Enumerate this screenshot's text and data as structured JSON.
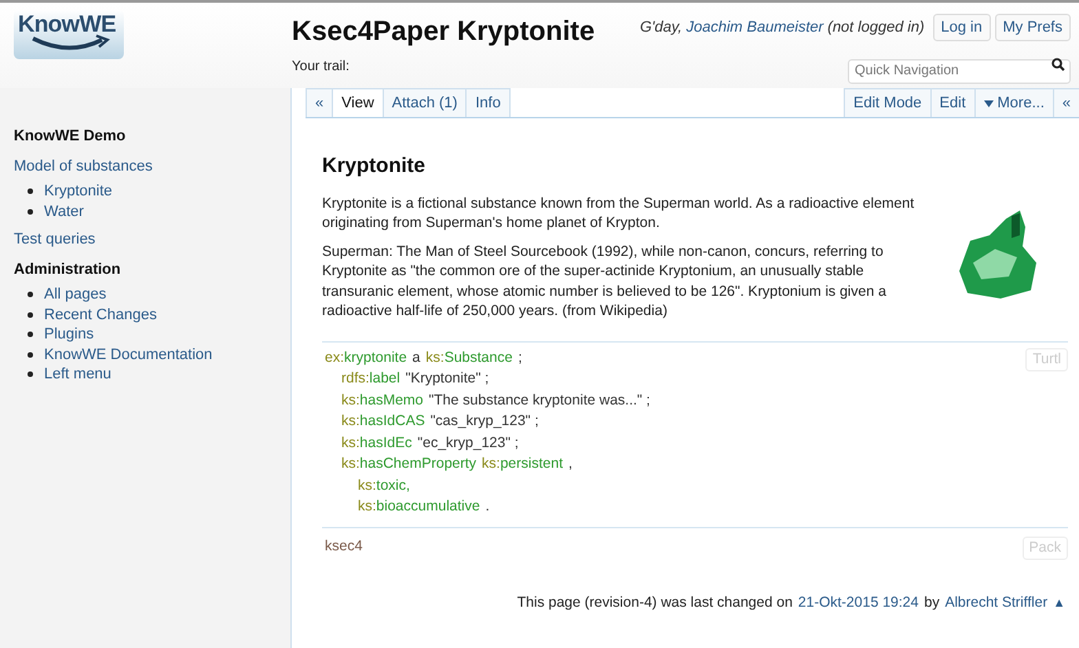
{
  "header": {
    "logo": "KnowWE",
    "title": "Ksec4Paper Kryptonite",
    "greeting": "G'day,",
    "user": "Joachim Baumeister",
    "login_state": "(not logged in)",
    "buttons": [
      "Log in",
      "My Prefs"
    ],
    "search": {
      "placeholder": "Quick Navigation"
    },
    "trail": "Your trail:"
  },
  "tabs_left": [
    {
      "label": "«",
      "selected": false
    },
    {
      "label": "View",
      "selected": true
    },
    {
      "label": "Attach (1)",
      "selected": false
    },
    {
      "label": "Info",
      "selected": false
    }
  ],
  "tabs_right": [
    {
      "label": "Edit Mode",
      "caret": false
    },
    {
      "label": "Edit",
      "caret": false
    },
    {
      "label": "More...",
      "caret": true
    },
    {
      "label": "«",
      "caret": false
    }
  ],
  "sidebar": {
    "sections": [
      {
        "kind": "heading",
        "label": "KnowWE Demo"
      },
      {
        "kind": "link",
        "label": "Model of substances",
        "items": [
          "Kryptonite",
          "Water"
        ]
      },
      {
        "kind": "link",
        "label": "Test queries"
      },
      {
        "kind": "heading",
        "label": "Administration",
        "items": [
          "All pages",
          "Recent Changes",
          "Plugins",
          "KnowWE Documentation",
          "Left menu"
        ]
      }
    ]
  },
  "article": {
    "title": "Kryptonite",
    "paragraphs": [
      "Kryptonite is a fictional substance known from the Superman world. As a radioactive element originating from Superman's home planet of Krypton.",
      "Superman: The Man of Steel Sourcebook (1992), while non-canon, concurs, referring to Kryptonite as \"the common ore of the super-actinide Kryptonium, an unusually stable transuranic element, whose atomic number is believed to be 126\". Kryptonium is given a radioactive half-life of 250,000 years. (from Wikipedia)"
    ]
  },
  "code_block": {
    "tag": "Turtl",
    "statements": [
      {
        "tokens": [
          {
            "kind": "prefix",
            "text": "ex:"
          },
          {
            "kind": "term",
            "text": "kryptonite"
          },
          {
            "kind": "text",
            "text": "a"
          },
          {
            "kind": "prefix",
            "text": "ks:"
          },
          {
            "kind": "term",
            "text": "Substance"
          },
          {
            "kind": "text",
            "text": ";"
          }
        ],
        "children": [
          {
            "tokens": [
              {
                "kind": "prefix",
                "text": "rdfs:"
              },
              {
                "kind": "term",
                "text": "label"
              },
              {
                "kind": "text",
                "text": "\"Kryptonite\" ;"
              }
            ]
          },
          {
            "tokens": [
              {
                "kind": "prefix",
                "text": "ks:"
              },
              {
                "kind": "term",
                "text": "hasMemo"
              },
              {
                "kind": "text",
                "text": "\"The substance kryptonite was...\" ;"
              }
            ]
          },
          {
            "tokens": [
              {
                "kind": "prefix",
                "text": "ks:"
              },
              {
                "kind": "term",
                "text": "hasIdCAS"
              },
              {
                "kind": "text",
                "text": "\"cas_kryp_123\" ;"
              }
            ]
          },
          {
            "tokens": [
              {
                "kind": "prefix",
                "text": "ks:"
              },
              {
                "kind": "term",
                "text": "hasIdEc"
              },
              {
                "kind": "text",
                "text": "\"ec_kryp_123\" ;"
              }
            ]
          },
          {
            "tokens": [
              {
                "kind": "prefix",
                "text": "ks:"
              },
              {
                "kind": "term",
                "text": "hasChemProperty"
              },
              {
                "kind": "prefix",
                "text": "ks:"
              },
              {
                "kind": "term",
                "text": "persistent"
              },
              {
                "kind": "text",
                "text": ","
              }
            ],
            "children": [
              {
                "tokens": [
                  {
                    "kind": "prefix",
                    "text": "ks:"
                  },
                  {
                    "kind": "term",
                    "text": "toxic,"
                  }
                ]
              },
              {
                "tokens": [
                  {
                    "kind": "prefix",
                    "text": "ks:"
                  },
                  {
                    "kind": "term",
                    "text": "bioaccumulative"
                  },
                  {
                    "kind": "text",
                    "text": "."
                  }
                ]
              }
            ]
          }
        ]
      }
    ]
  },
  "package_block": {
    "name": "ksec4",
    "tag": "Pack"
  },
  "footer": {
    "text": "This page (revision-4) was last changed on",
    "date": "21-Okt-2015 19:24",
    "by": "by",
    "author": "Albrecht Striffler",
    "top_link": "▲"
  }
}
